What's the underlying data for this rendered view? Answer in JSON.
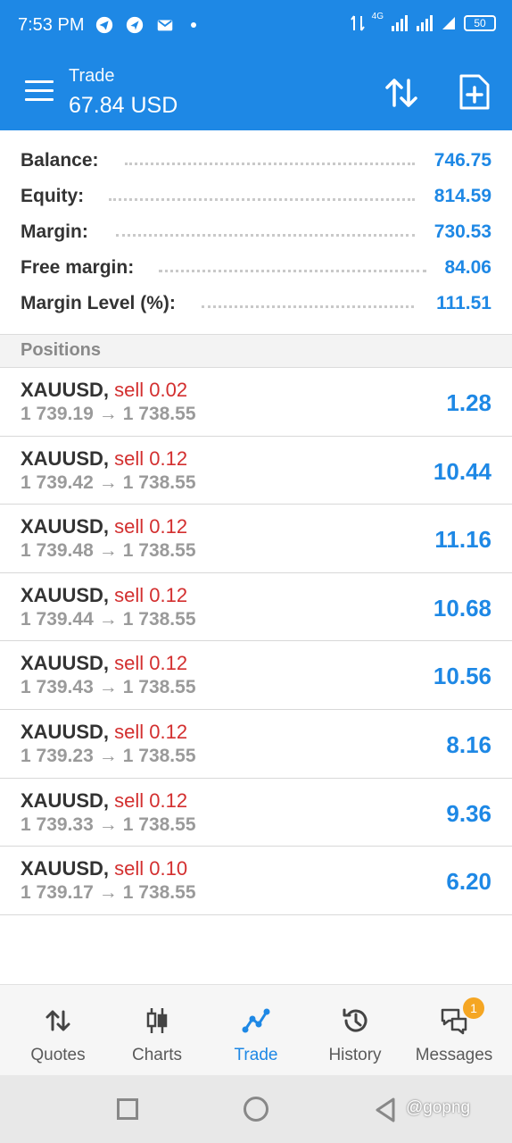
{
  "status_bar": {
    "time": "7:53 PM",
    "network": "4G",
    "battery": "50"
  },
  "app_bar": {
    "title": "Trade",
    "subtitle": "67.84 USD"
  },
  "summary": [
    {
      "label": "Balance:",
      "value": "746.75"
    },
    {
      "label": "Equity:",
      "value": "814.59"
    },
    {
      "label": "Margin:",
      "value": "730.53"
    },
    {
      "label": "Free margin:",
      "value": "84.06"
    },
    {
      "label": "Margin Level (%):",
      "value": "111.51"
    }
  ],
  "positions_header": "Positions",
  "positions": [
    {
      "symbol": "XAUUSD,",
      "type": "sell 0.02",
      "open": "1 739.19",
      "current": "1 738.55",
      "profit": "1.28"
    },
    {
      "symbol": "XAUUSD,",
      "type": "sell 0.12",
      "open": "1 739.42",
      "current": "1 738.55",
      "profit": "10.44"
    },
    {
      "symbol": "XAUUSD,",
      "type": "sell 0.12",
      "open": "1 739.48",
      "current": "1 738.55",
      "profit": "11.16"
    },
    {
      "symbol": "XAUUSD,",
      "type": "sell 0.12",
      "open": "1 739.44",
      "current": "1 738.55",
      "profit": "10.68"
    },
    {
      "symbol": "XAUUSD,",
      "type": "sell 0.12",
      "open": "1 739.43",
      "current": "1 738.55",
      "profit": "10.56"
    },
    {
      "symbol": "XAUUSD,",
      "type": "sell 0.12",
      "open": "1 739.23",
      "current": "1 738.55",
      "profit": "8.16"
    },
    {
      "symbol": "XAUUSD,",
      "type": "sell 0.12",
      "open": "1 739.33",
      "current": "1 738.55",
      "profit": "9.36"
    },
    {
      "symbol": "XAUUSD,",
      "type": "sell 0.10",
      "open": "1 739.17",
      "current": "1 738.55",
      "profit": "6.20"
    }
  ],
  "arrow_glyph": "→",
  "bottom_nav": [
    {
      "label": "Quotes",
      "icon": "quotes-icon"
    },
    {
      "label": "Charts",
      "icon": "charts-icon"
    },
    {
      "label": "Trade",
      "icon": "trade-icon",
      "active": true
    },
    {
      "label": "History",
      "icon": "history-icon"
    },
    {
      "label": "Messages",
      "icon": "messages-icon",
      "badge": "1"
    }
  ],
  "watermark": "@gopng",
  "colors": {
    "accent": "#1e88e5",
    "sell": "#d32f2f",
    "badge": "#f5a623"
  }
}
